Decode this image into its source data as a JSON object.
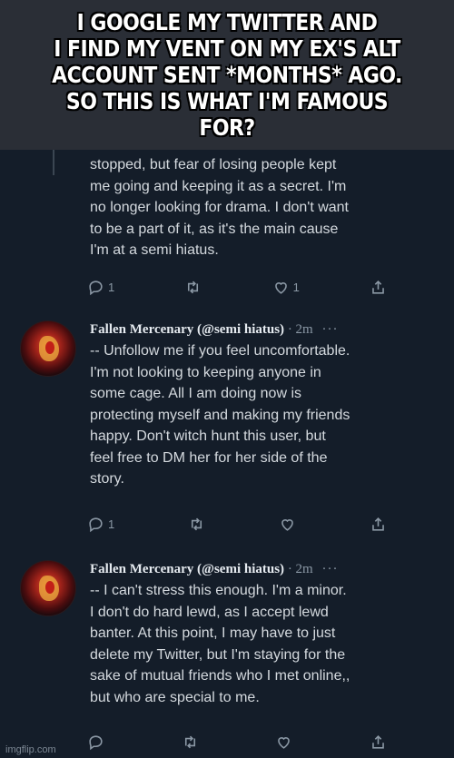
{
  "caption": "I GOOGLE MY TWITTER AND\nI FIND MY VENT ON MY EX'S ALT\nACCOUNT SENT *MONTHS* AGO.\nSO THIS IS WHAT I'M FAMOUS FOR?",
  "tweets": [
    {
      "text": "stopped, but fear of losing people kept\nme going and keeping it as a secret. I'm\nno longer looking for drama. I don't want\nto be a part of it, as it's the main cause\nI'm at a semi hiatus.",
      "reply_count": "1",
      "like_count": "1"
    },
    {
      "name": "Fallen Mercenary",
      "handle": "(@semi hiatus)",
      "time": "· 2m",
      "text": "-- Unfollow me if you feel uncomfortable.\nI'm not looking to keeping anyone in\nsome cage. All I am doing now is\nprotecting myself and making my friends\nhappy. Don't witch hunt this user, but\nfeel free to DM her for her side of the\nstory.",
      "reply_count": "1"
    },
    {
      "name": "Fallen Mercenary",
      "handle": "(@semi hiatus)",
      "time": "· 2m",
      "text": "-- I can't stress this enough. I'm a minor.\nI don't do hard lewd, as I accept lewd\nbanter. At this point, I may have to just\ndelete my Twitter, but I'm staying for the\nsake of mutual friends who I met online,,\nbut who are special to me."
    }
  ],
  "more_glyph": "···",
  "icons": [
    "reply-icon",
    "retweet-icon",
    "like-icon",
    "share-icon",
    "more-icon"
  ],
  "watermark": "imgflip.com",
  "colors": {
    "background": "#141d29",
    "caption_bg": "#2a2e36",
    "text": "#d4d9de",
    "muted": "#8b98a5"
  }
}
